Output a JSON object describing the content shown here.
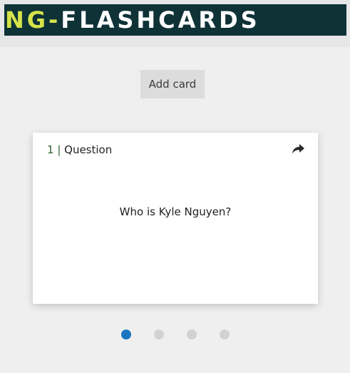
{
  "header": {
    "logo_prefix": "NG-",
    "logo_rest": "FLASHCARDS"
  },
  "toolbar": {
    "add_card_label": "Add card"
  },
  "card": {
    "number": "1",
    "separator": " | ",
    "side_label": "Question",
    "text": "Who is Kyle Nguyen?",
    "flip_icon": "share-forward-icon"
  },
  "pagination": {
    "total": 4,
    "active_index": 0
  },
  "colors": {
    "logo_bg": "#0f3237",
    "logo_accent": "#d6e34a",
    "dot_active": "#1c76bf",
    "dot_inactive": "#d2d2d2"
  }
}
